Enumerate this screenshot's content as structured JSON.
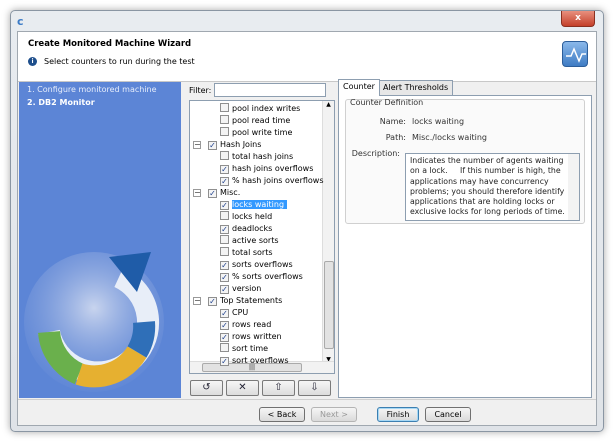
{
  "window": {
    "title_icon": "app-logo-icon",
    "close_label": "x"
  },
  "header": {
    "title": "Create Monitored Machine Wizard",
    "subtitle": "Select counters to run during the test",
    "info_icon": "i"
  },
  "steps": [
    {
      "label": "1. Configure monitored machine",
      "active": false
    },
    {
      "label": "2. DB2 Monitor",
      "active": true
    }
  ],
  "filter": {
    "label": "Filter:",
    "value": ""
  },
  "tree": [
    {
      "label": "pool index writes",
      "level": 2,
      "checked": false
    },
    {
      "label": "pool read time",
      "level": 2,
      "checked": false
    },
    {
      "label": "pool write time",
      "level": 2,
      "checked": false
    },
    {
      "label": "Hash Joins",
      "level": 1,
      "checked": true
    },
    {
      "label": "total hash joins",
      "level": 2,
      "checked": false
    },
    {
      "label": "hash joins overflows",
      "level": 2,
      "checked": true
    },
    {
      "label": "% hash joins overflows",
      "level": 2,
      "checked": true
    },
    {
      "label": "Misc.",
      "level": 1,
      "checked": true
    },
    {
      "label": "locks waiting",
      "level": 2,
      "checked": true,
      "selected": true
    },
    {
      "label": "locks held",
      "level": 2,
      "checked": false
    },
    {
      "label": "deadlocks",
      "level": 2,
      "checked": true
    },
    {
      "label": "active sorts",
      "level": 2,
      "checked": false
    },
    {
      "label": "total sorts",
      "level": 2,
      "checked": false
    },
    {
      "label": "sorts overflows",
      "level": 2,
      "checked": true
    },
    {
      "label": "% sorts overflows",
      "level": 2,
      "checked": true
    },
    {
      "label": "version",
      "level": 2,
      "checked": true
    },
    {
      "label": "Top Statements",
      "level": 1,
      "checked": true
    },
    {
      "label": "CPU",
      "level": 2,
      "checked": true
    },
    {
      "label": "rows read",
      "level": 2,
      "checked": true
    },
    {
      "label": "rows written",
      "level": 2,
      "checked": true
    },
    {
      "label": "sort time",
      "level": 2,
      "checked": false
    },
    {
      "label": "sort overflows",
      "level": 2,
      "checked": true
    }
  ],
  "tree_buttons": [
    {
      "name": "reset-button",
      "glyph": "↺"
    },
    {
      "name": "remove-button",
      "glyph": "✕"
    },
    {
      "name": "export-button",
      "glyph": "⇧"
    },
    {
      "name": "import-button",
      "glyph": "⇩"
    }
  ],
  "tabs": [
    {
      "label": "Counter",
      "active": true
    },
    {
      "label": "Alert Thresholds",
      "active": false
    }
  ],
  "counter": {
    "group_label": "Counter Definition",
    "name_label": "Name:",
    "name": "locks waiting",
    "path_label": "Path:",
    "path": "Misc./locks waiting",
    "description_label": "Description:",
    "description": "Indicates the number of agents waiting on a lock.     If this number is high, the applications may have concurrency problems; you should therefore identify applications that are holding locks or exclusive locks for long periods of time."
  },
  "footer": {
    "back": "< Back",
    "next": "Next >",
    "finish": "Finish",
    "cancel": "Cancel"
  }
}
